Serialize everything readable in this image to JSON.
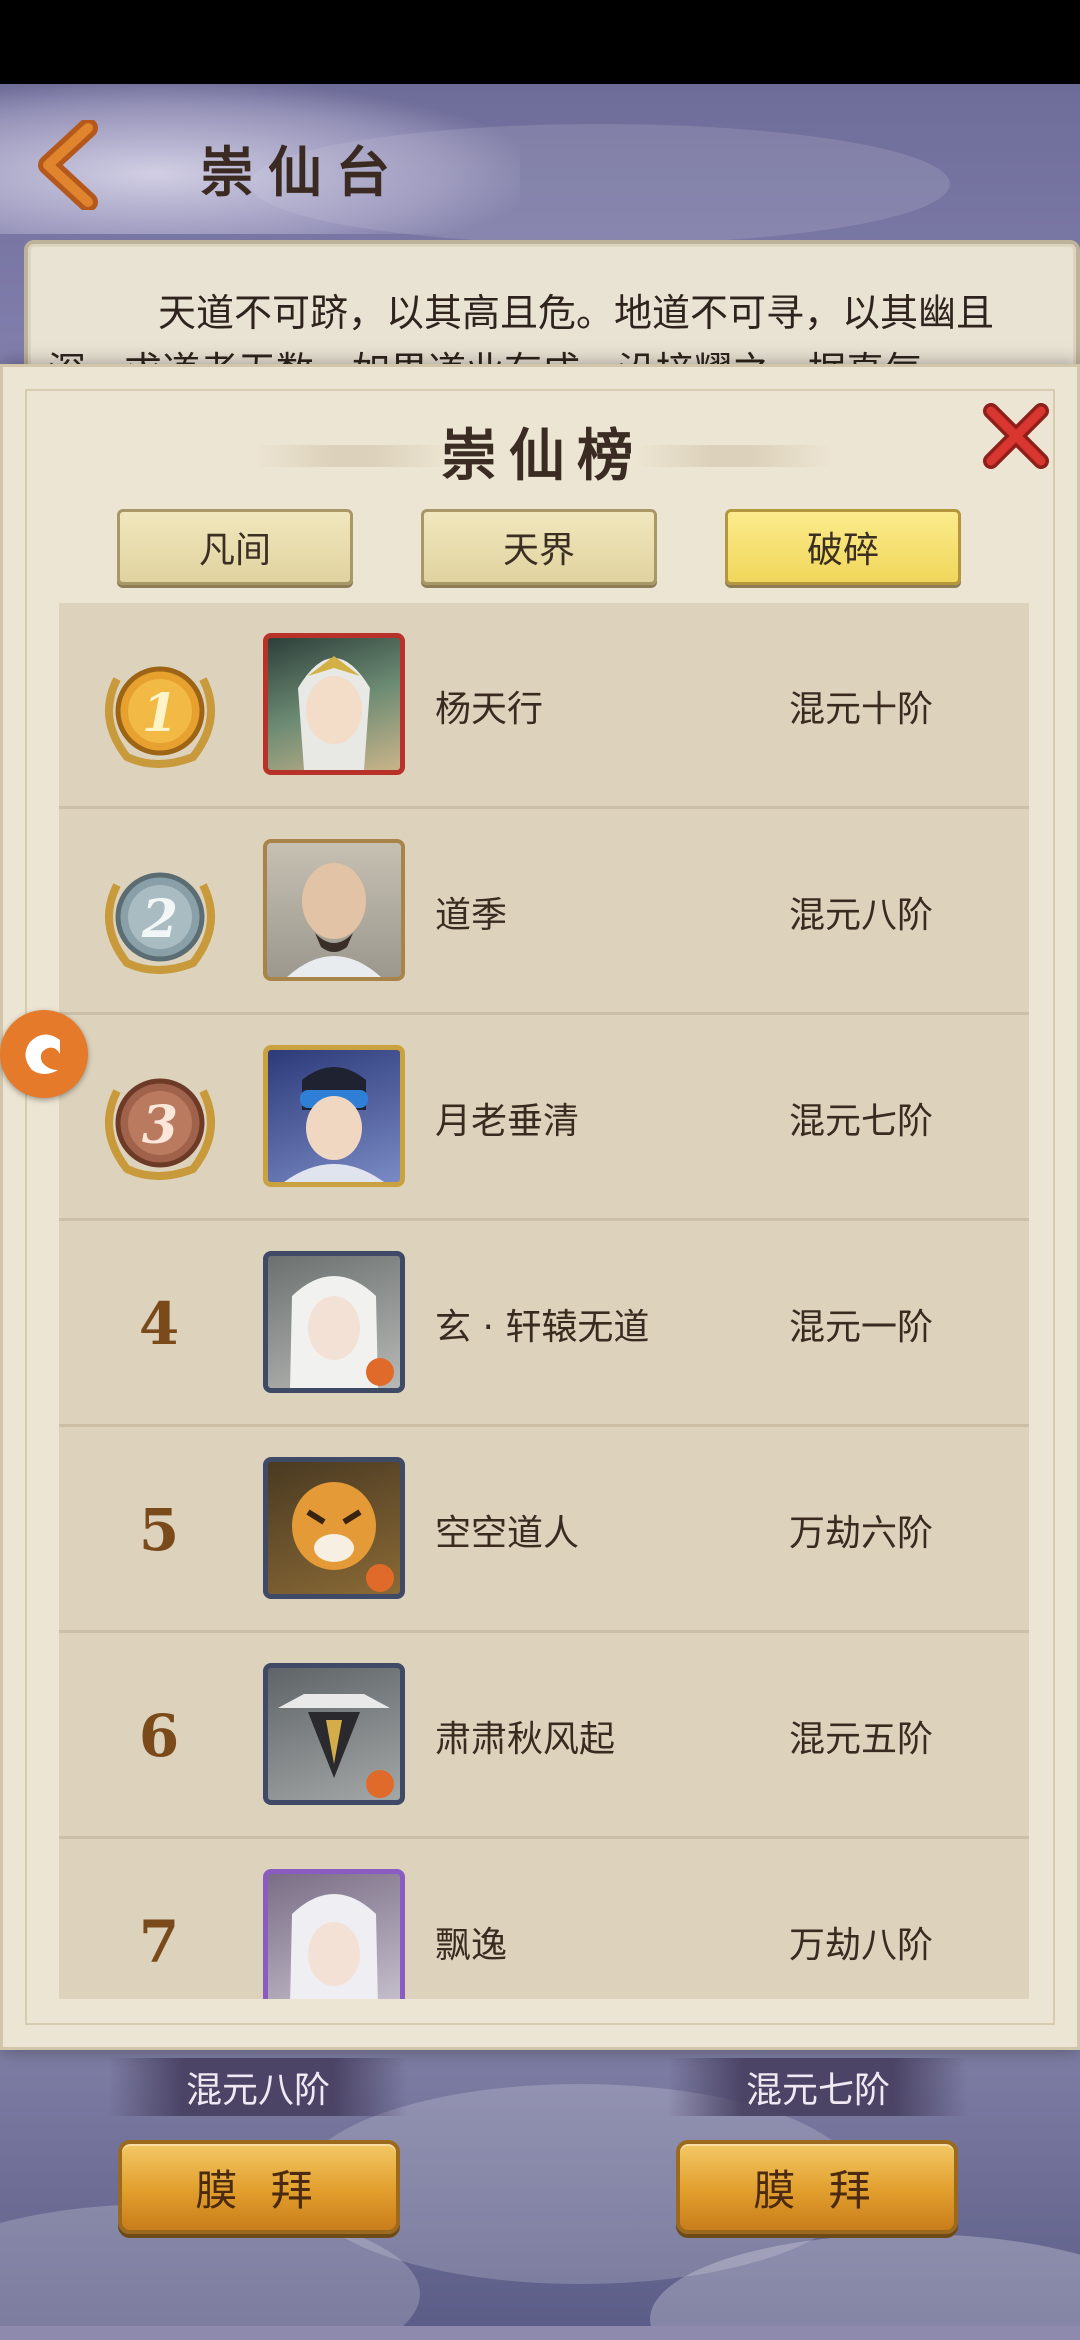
{
  "header": {
    "title": "崇仙台",
    "intro_text": "天道不可跻，以其高且危。地道不可寻，以其幽且深。求道者无数，如果道业有成，沿接耀之，据真气"
  },
  "modal": {
    "title": "崇仙榜",
    "tabs": [
      {
        "label": "凡间",
        "active": false
      },
      {
        "label": "天界",
        "active": false
      },
      {
        "label": "破碎",
        "active": true
      }
    ]
  },
  "rankings": [
    {
      "rank": "1",
      "name": "杨天行",
      "level": "混元十阶",
      "medal": "gold"
    },
    {
      "rank": "2",
      "name": "道季",
      "level": "混元八阶",
      "medal": "silver"
    },
    {
      "rank": "3",
      "name": "月老垂清",
      "level": "混元七阶",
      "medal": "bronze"
    },
    {
      "rank": "4",
      "name": "玄 · 轩辕无道",
      "level": "混元一阶"
    },
    {
      "rank": "5",
      "name": "空空道人",
      "level": "万劫六阶"
    },
    {
      "rank": "6",
      "name": "肃肃秋风起",
      "level": "混元五阶"
    },
    {
      "rank": "7",
      "name": "飘逸",
      "level": "万劫八阶"
    }
  ],
  "bottom": {
    "left_level": "混元八阶",
    "right_level": "混元七阶",
    "worship_label": "膜 拜"
  },
  "colors": {
    "accent_gold": "#f0d65a",
    "panel_bg": "#ede5d3",
    "close_red": "#c9302c",
    "float_orange": "#e47a2a"
  },
  "icons": {
    "back": "back-arrow-icon",
    "close": "close-icon",
    "side": "dragon-float-icon"
  }
}
